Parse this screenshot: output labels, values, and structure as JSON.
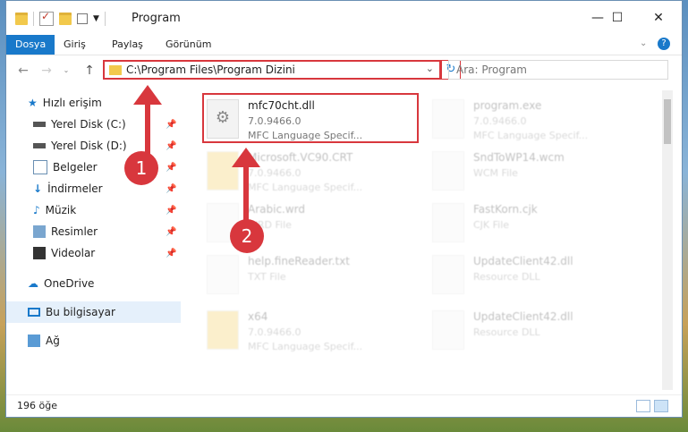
{
  "window": {
    "title": "Program"
  },
  "ribbon": {
    "tabs": [
      "Dosya",
      "Giriş",
      "Paylaş",
      "Görünüm"
    ]
  },
  "address": {
    "path": "C:\\Program Files\\Program Dizini",
    "search_placeholder": "Ara: Program"
  },
  "sidebar": {
    "quick_access": "Hızlı erişim",
    "items": [
      "Yerel Disk (C:)",
      "Yerel Disk (D:)",
      "Belgeler",
      "İndirmeler",
      "Müzik",
      "Resimler",
      "Videolar"
    ],
    "onedrive": "OneDrive",
    "this_pc": "Bu bilgisayar",
    "network": "Ağ"
  },
  "files": [
    {
      "name": "mfc70cht.dll",
      "line2": "7.0.9466.0",
      "line3": "MFC Language Specif..."
    },
    {
      "name": "program.exe",
      "line2": "7.0.9466.0",
      "line3": "MFC Language Specif..."
    },
    {
      "name": "Microsoft.VC90.CRT",
      "line2": "7.0.9466.0",
      "line3": "MFC Language Specif..."
    },
    {
      "name": "SndToWP14.wcm",
      "line2": "WCM File",
      "line3": ""
    },
    {
      "name": "Arabic.wrd",
      "line2": "WRD File",
      "line3": ""
    },
    {
      "name": "FastKorn.cjk",
      "line2": "CJK File",
      "line3": ""
    },
    {
      "name": "help.fineReader.txt",
      "line2": "TXT File",
      "line3": ""
    },
    {
      "name": "UpdateClient42.dll",
      "line2": "Resource DLL",
      "line3": ""
    },
    {
      "name": "x64",
      "line2": "7.0.9466.0",
      "line3": "MFC Language Specif..."
    },
    {
      "name": "UpdateClient42.dll",
      "line2": "Resource DLL",
      "line3": ""
    }
  ],
  "annotations": [
    "1",
    "2"
  ],
  "status": {
    "count": "196 öğe"
  },
  "colors": {
    "accent": "#1979ca",
    "highlight": "#d8373d"
  }
}
